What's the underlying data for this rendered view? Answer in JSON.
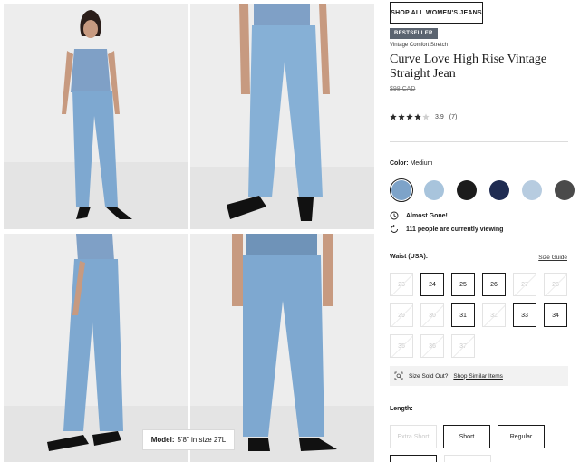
{
  "model_caption": {
    "label": "Model:",
    "value": "5'8\" in size 27L"
  },
  "shop_all_label": "SHOP ALL WOMEN'S JEANS",
  "badge": "BESTSELLER",
  "subtitle": "Vintage Comfort Stretch",
  "title": "Curve Love High Rise Vintage Straight Jean",
  "price": "$98 CAD",
  "rating": {
    "stars": 4,
    "score": "3.9",
    "count": "(7)"
  },
  "color": {
    "label": "Color:",
    "selected": "Medium",
    "swatches": [
      "#7da3c9",
      "#a8c4dc",
      "#1c1c1c",
      "#1f2c52",
      "#b7cce0",
      "#4a4a4a"
    ]
  },
  "alerts": {
    "almost_gone": "Almost Gone!",
    "viewing": "111 people are currently viewing"
  },
  "waist": {
    "label": "Waist (USA):",
    "size_guide": "Size Guide",
    "sizes": [
      {
        "value": "23",
        "available": false
      },
      {
        "value": "24",
        "available": true
      },
      {
        "value": "25",
        "available": true
      },
      {
        "value": "26",
        "available": true
      },
      {
        "value": "27",
        "available": false
      },
      {
        "value": "28",
        "available": false
      },
      {
        "value": "29",
        "available": false
      },
      {
        "value": "30",
        "available": false
      },
      {
        "value": "31",
        "available": true
      },
      {
        "value": "32",
        "available": false
      },
      {
        "value": "33",
        "available": true
      },
      {
        "value": "34",
        "available": true
      },
      {
        "value": "35",
        "available": false
      },
      {
        "value": "36",
        "available": false
      },
      {
        "value": "37",
        "available": false
      }
    ]
  },
  "soldout": {
    "text": "Size Sold Out?",
    "link": "Shop Similar Items"
  },
  "length": {
    "label": "Length:",
    "options": [
      {
        "value": "Extra Short",
        "available": false
      },
      {
        "value": "Short",
        "available": true
      },
      {
        "value": "Regular",
        "available": true
      }
    ]
  }
}
